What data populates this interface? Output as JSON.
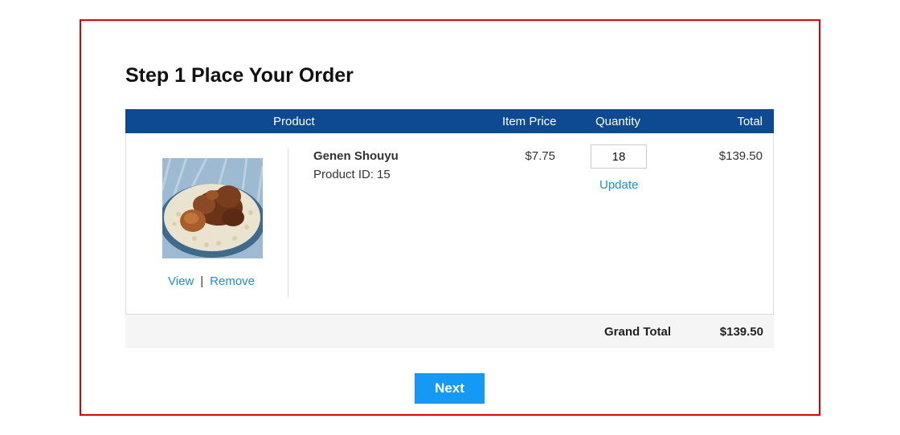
{
  "page": {
    "title": "Step 1 Place Your Order"
  },
  "cart": {
    "columns": {
      "product": "Product",
      "item_price": "Item Price",
      "quantity": "Quantity",
      "total": "Total"
    },
    "items": [
      {
        "name": "Genen Shouyu",
        "product_id_label": "Product ID:",
        "product_id": "15",
        "price": "$7.75",
        "quantity": "18",
        "total": "$139.50",
        "view_label": "View",
        "separator": "|",
        "remove_label": "Remove",
        "update_label": "Update",
        "image_icon": "food-photo"
      }
    ],
    "grand_total_label": "Grand Total",
    "grand_total": "$139.50"
  },
  "actions": {
    "next_label": "Next"
  },
  "colors": {
    "header_bg": "#0e4a91",
    "link": "#1a8fe0",
    "primary_button": "#1499f5",
    "frame_border": "#e00000"
  }
}
